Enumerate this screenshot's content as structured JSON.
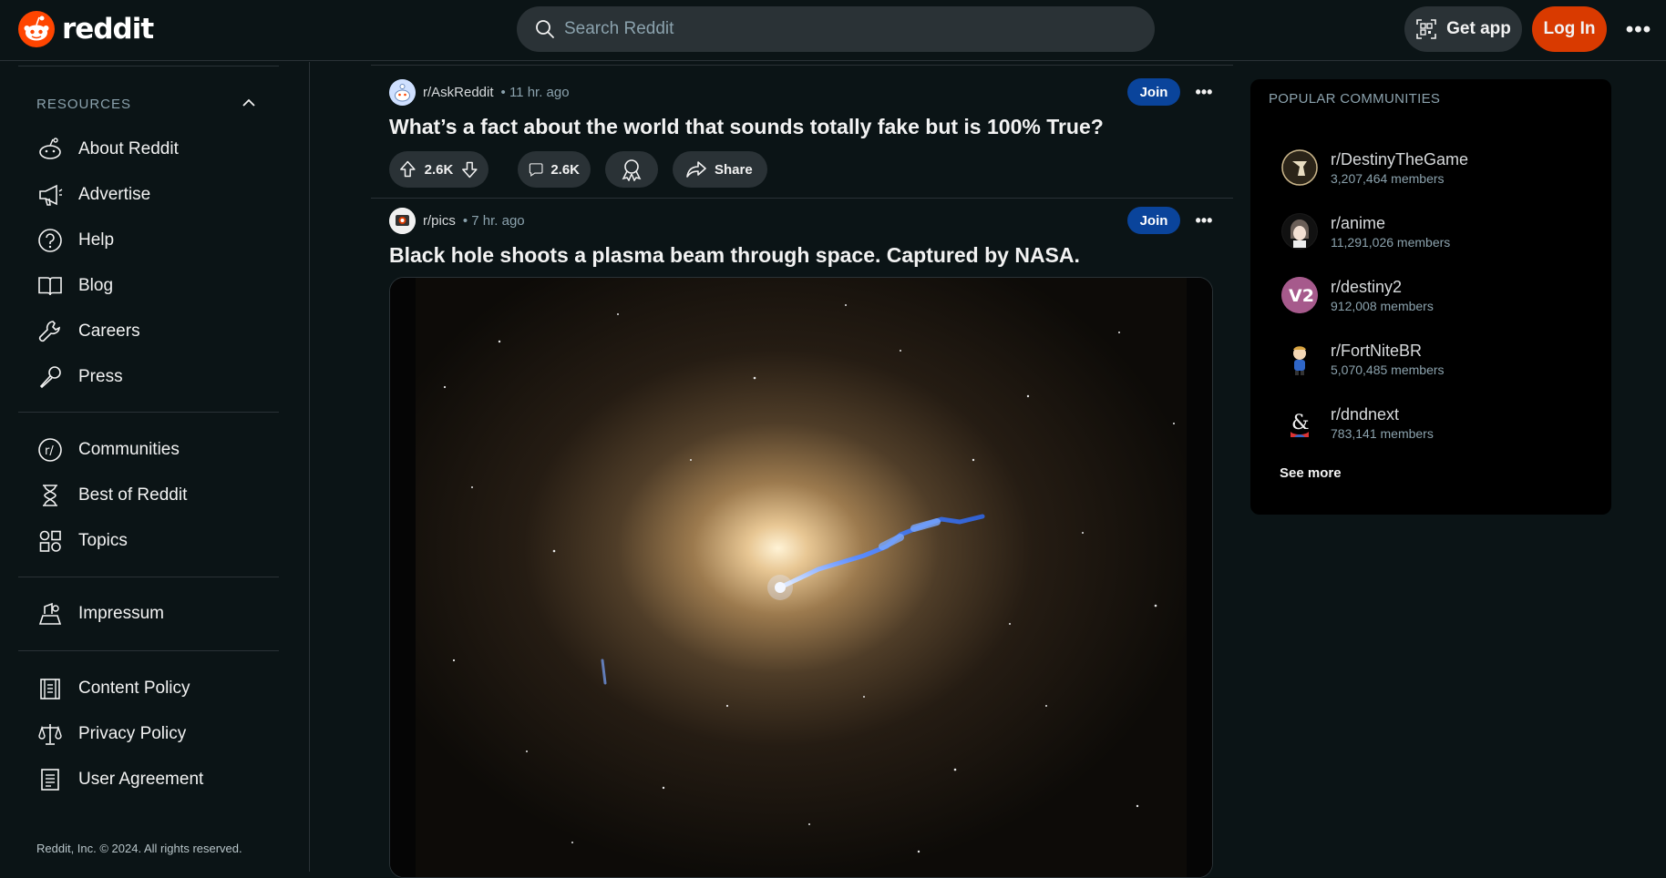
{
  "header": {
    "logo_text": "reddit",
    "search_placeholder": "Search Reddit",
    "get_app_label": "Get app",
    "login_label": "Log In",
    "more_label": "•••"
  },
  "sidebar": {
    "resources_title": "RESOURCES",
    "group1": [
      {
        "label": "About Reddit",
        "icon": "reddit-alien-icon"
      },
      {
        "label": "Advertise",
        "icon": "megaphone-icon"
      },
      {
        "label": "Help",
        "icon": "help-icon"
      },
      {
        "label": "Blog",
        "icon": "book-icon"
      },
      {
        "label": "Careers",
        "icon": "wrench-icon"
      },
      {
        "label": "Press",
        "icon": "microphone-icon"
      }
    ],
    "group2": [
      {
        "label": "Communities",
        "icon": "communities-icon"
      },
      {
        "label": "Best of Reddit",
        "icon": "hourglass-icon"
      },
      {
        "label": "Topics",
        "icon": "topics-icon"
      }
    ],
    "group3": [
      {
        "label": "Impressum",
        "icon": "impressum-icon"
      }
    ],
    "group4": [
      {
        "label": "Content Policy",
        "icon": "content-policy-icon"
      },
      {
        "label": "Privacy Policy",
        "icon": "scales-icon"
      },
      {
        "label": "User Agreement",
        "icon": "document-icon"
      }
    ],
    "copyright": "Reddit, Inc. © 2024. All rights reserved."
  },
  "feed": {
    "posts": [
      {
        "subreddit": "r/AskReddit",
        "time": "• 11 hr. ago",
        "join_label": "Join",
        "more_label": "•••",
        "title": "What’s a fact about the world that sounds totally fake but is 100% True?",
        "votes": "2.6K",
        "comments": "2.6K",
        "share_label": "Share"
      },
      {
        "subreddit": "r/pics",
        "time": "• 7 hr. ago",
        "join_label": "Join",
        "more_label": "•••",
        "title": "Black hole shoots a plasma beam through space. Captured by NASA."
      }
    ]
  },
  "popular": {
    "title": "POPULAR COMMUNITIES",
    "communities": [
      {
        "name": "r/DestinyTheGame",
        "members": "3,207,464 members"
      },
      {
        "name": "r/anime",
        "members": "11,291,026 members"
      },
      {
        "name": "r/destiny2",
        "members": "912,008 members"
      },
      {
        "name": "r/FortNiteBR",
        "members": "5,070,485 members"
      },
      {
        "name": "r/dndnext",
        "members": "783,141 members"
      }
    ],
    "see_more_label": "See more"
  },
  "colors": {
    "background": "#0b1416",
    "accent_login": "#d93a00",
    "join_blue": "#0a449b",
    "pill_bg": "#2a3236"
  }
}
